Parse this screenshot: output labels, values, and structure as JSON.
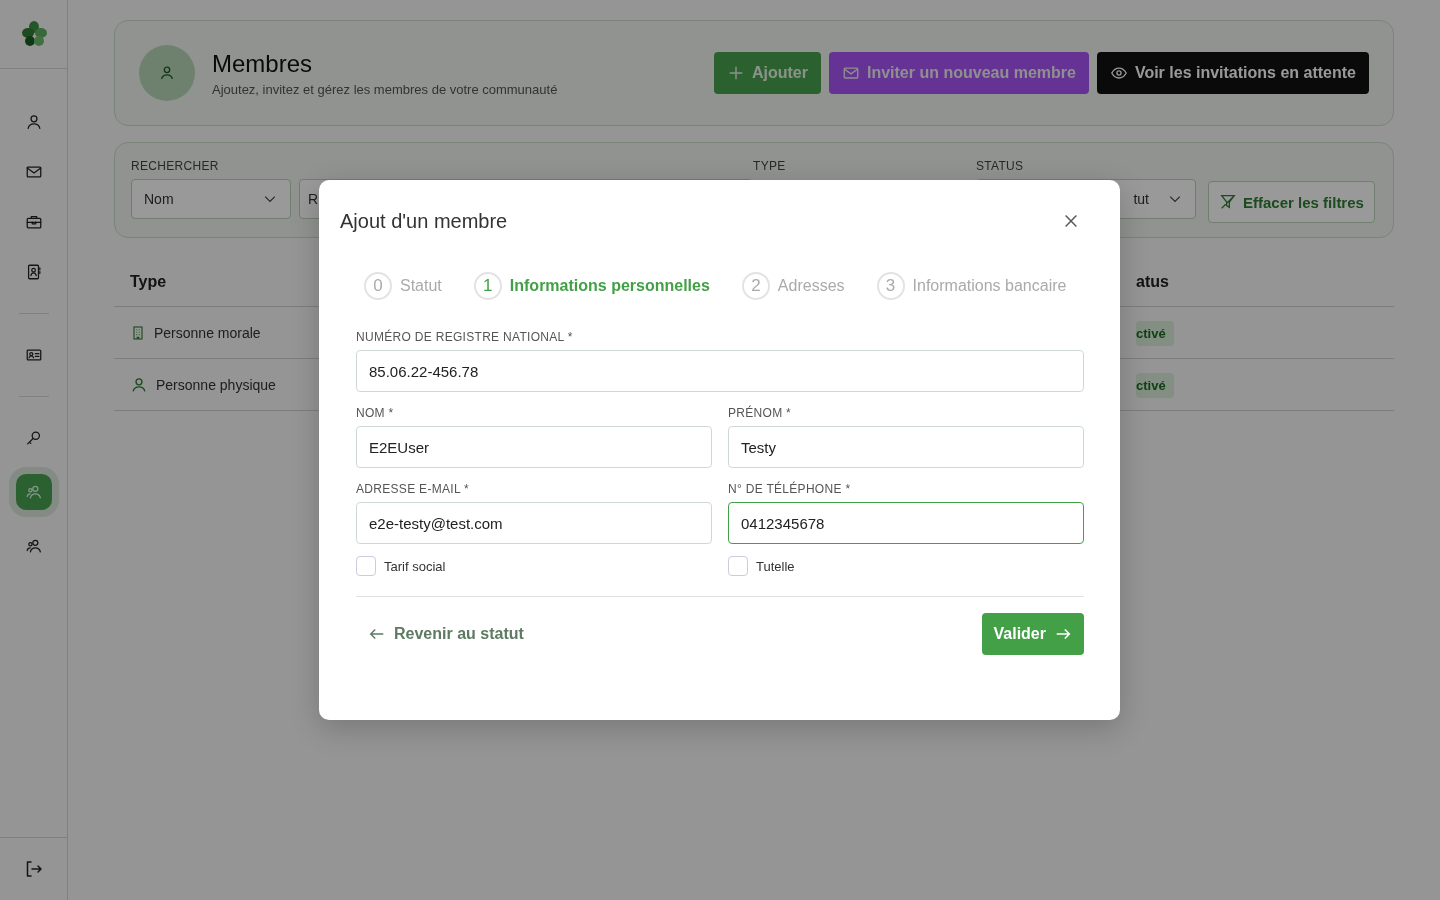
{
  "sidebar": {
    "items": [
      {
        "kind": "user",
        "selected": false
      },
      {
        "kind": "mail",
        "selected": false
      },
      {
        "kind": "briefcase",
        "selected": false
      },
      {
        "kind": "contacts",
        "selected": false
      },
      {
        "kind": "idcard",
        "selected": false
      },
      {
        "kind": "key",
        "selected": false
      },
      {
        "kind": "group",
        "selected": true
      },
      {
        "kind": "group",
        "selected": false
      }
    ]
  },
  "header": {
    "title": "Membres",
    "subtitle": "Ajoutez, invitez et gérez les membres de votre communauté",
    "buttons": [
      {
        "kind": "add",
        "label": "Ajouter"
      },
      {
        "kind": "invite",
        "label": "Inviter un nouveau membre"
      },
      {
        "kind": "pending",
        "label": "Voir les invitations en attente"
      }
    ]
  },
  "filters": {
    "search_label": "RECHERCHER",
    "search_by": "Nom",
    "search_value": "R",
    "type_label": "TYPE",
    "status_label": "STATUS",
    "status_value": "tut",
    "clear": "Effacer les filtres"
  },
  "table": {
    "columns": [
      "Type",
      "atus"
    ],
    "rows": [
      {
        "kind": "company",
        "type": "Personne morale",
        "status": "ctivé"
      },
      {
        "kind": "person",
        "type": "Personne physique",
        "status": "ctivé"
      }
    ]
  },
  "modal": {
    "title": "Ajout d'un membre",
    "steps": [
      {
        "number": "0",
        "label": "Statut",
        "selected": false
      },
      {
        "number": "1",
        "label": "Informations personnelles",
        "selected": true
      },
      {
        "number": "2",
        "label": "Adresses",
        "selected": false
      },
      {
        "number": "3",
        "label": "Informations bancaire",
        "selected": false
      }
    ],
    "fields": [
      {
        "label": "NUMÉRO DE REGISTRE NATIONAL *",
        "value": "85.06.22-456.78",
        "focused": false
      },
      {
        "label": "NOM *",
        "value": "E2EUser",
        "focused": false
      },
      {
        "label": "PRÉNOM *",
        "value": "Testy",
        "focused": false
      },
      {
        "label": "ADRESSE E-MAIL *",
        "value": "e2e-testy@test.com",
        "focused": false
      },
      {
        "label": "N° DE TÉLÉPHONE *",
        "value": "0412345678",
        "focused": true
      }
    ],
    "checkboxes": [
      {
        "label": "Tarif social",
        "checked": false
      },
      {
        "label": "Tutelle",
        "checked": false
      }
    ],
    "back": "Revenir au statut",
    "submit": "Valider"
  }
}
